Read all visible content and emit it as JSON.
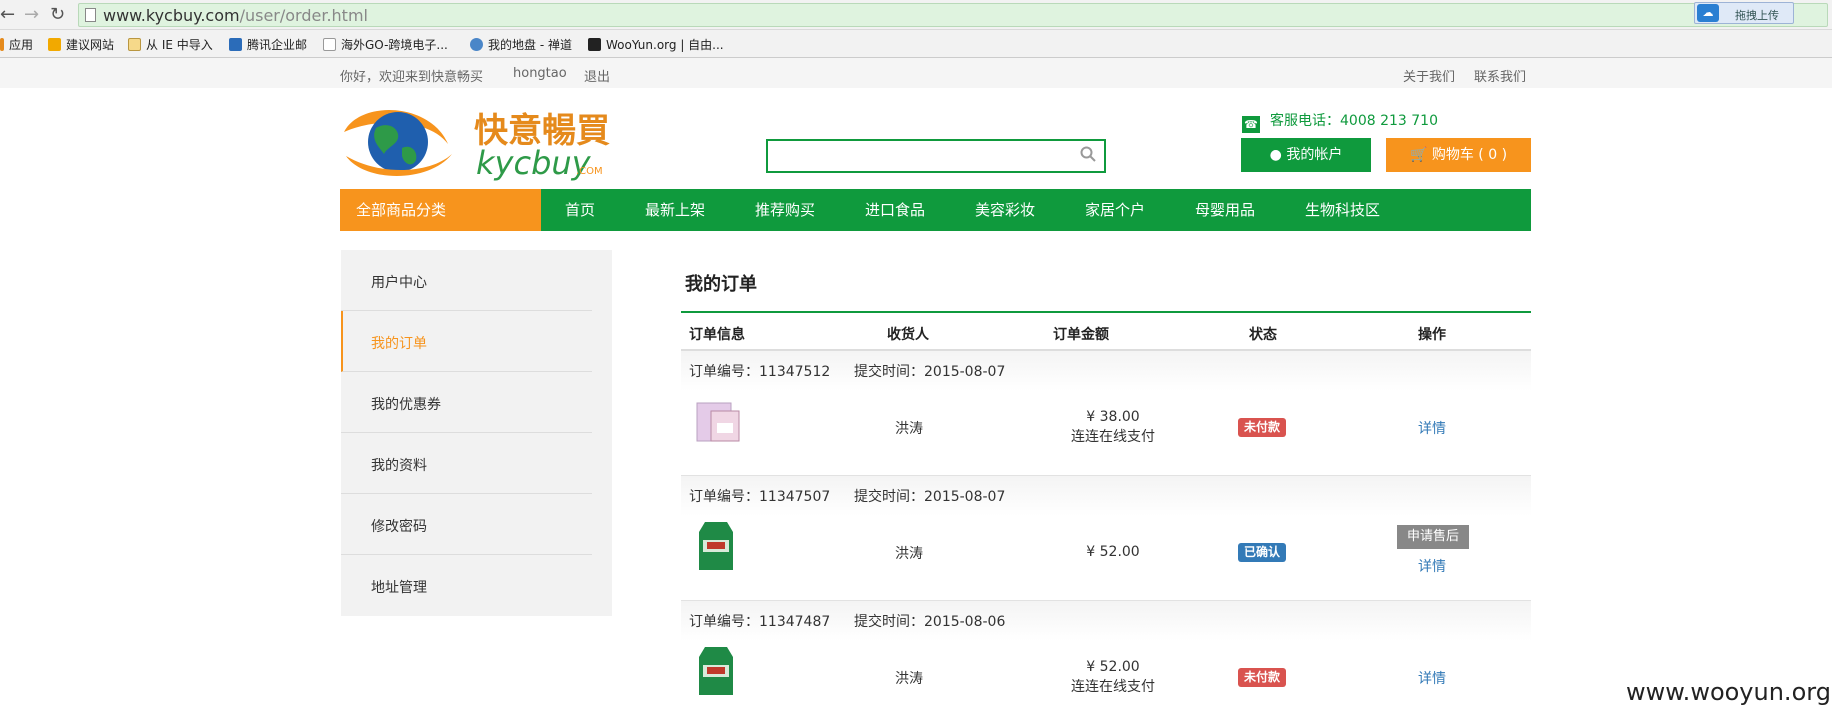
{
  "browser": {
    "url_host": "www.kycbuy.com",
    "url_path": "/user/order.html",
    "upload_label": "拖拽上传",
    "bookmarks": [
      "应用",
      "建议网站",
      "从 IE 中导入",
      "腾讯企业邮",
      "海外GO-跨境电子...",
      "我的地盘 - 禅道",
      "WooYun.org | 自由..."
    ]
  },
  "topbar": {
    "welcome": "你好，欢迎来到快意畅买",
    "username": "hongtao",
    "logout": "退出",
    "about": "关于我们",
    "contact": "联系我们"
  },
  "header": {
    "logo_cn": "快意暢買",
    "logo_en": "kycbuy",
    "logo_com": ".COM",
    "search_placeholder": "",
    "hotline": "客服电话：4008 213 710",
    "account_btn": "我的帐户",
    "cart_btn": "购物车 ( 0 )"
  },
  "nav": {
    "all_categories": "全部商品分类",
    "items": [
      "首页",
      "最新上架",
      "推荐购买",
      "进口食品",
      "美容彩妆",
      "家居个户",
      "母婴用品",
      "生物科技区"
    ]
  },
  "sidebar": {
    "items": [
      "用户中心",
      "我的订单",
      "我的优惠券",
      "我的资料",
      "修改密码",
      "地址管理"
    ]
  },
  "main": {
    "title": "我的订单",
    "columns": [
      "订单信息",
      "收货人",
      "订单金额",
      "状态",
      "操作"
    ],
    "orders": [
      {
        "number": "订单编号：11347512",
        "time": "提交时间：2015-08-07",
        "receiver": "洪涛",
        "amount": "¥ 38.00",
        "payment": "连连在线支付",
        "status": "未付款",
        "action": "详情",
        "aftersale": ""
      },
      {
        "number": "订单编号：11347507",
        "time": "提交时间：2015-08-07",
        "receiver": "洪涛",
        "amount": "¥ 52.00",
        "payment": "",
        "status": "已确认",
        "action": "详情",
        "aftersale": "申请售后"
      },
      {
        "number": "订单编号：11347487",
        "time": "提交时间：2015-08-06",
        "receiver": "洪涛",
        "amount": "¥ 52.00",
        "payment": "连连在线支付",
        "status": "未付款",
        "action": "详情",
        "aftersale": ""
      }
    ]
  },
  "watermark": "www.wooyun.org",
  "colors": {
    "brand_green": "#0f9a3d",
    "brand_orange": "#f7941d",
    "unpaid_red": "#d9534f",
    "confirmed_blue": "#337ab7"
  }
}
